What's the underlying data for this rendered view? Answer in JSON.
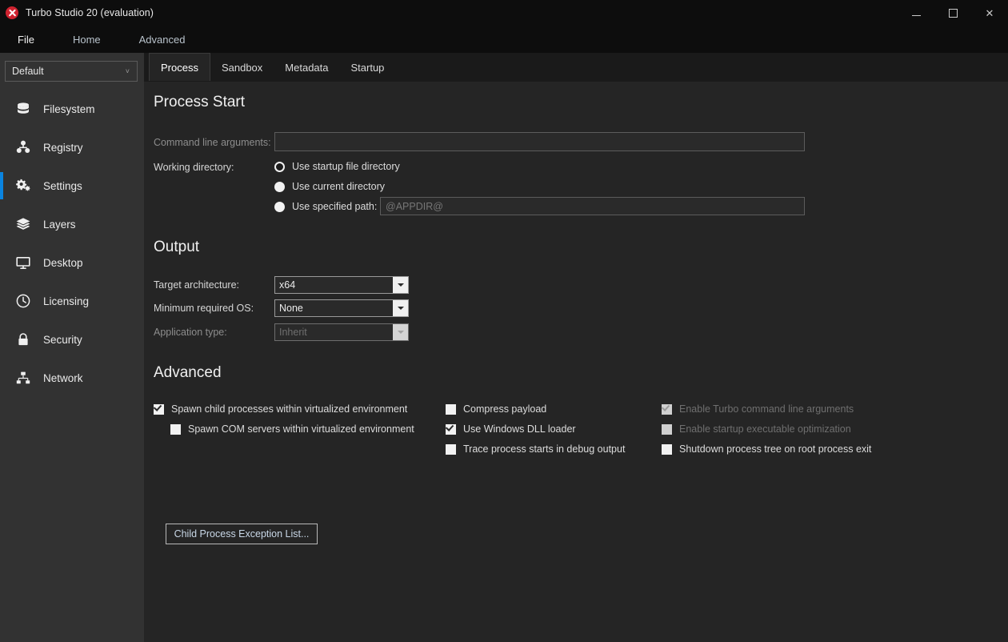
{
  "window": {
    "title": "Turbo Studio 20 (evaluation)",
    "app_icon": "turbo-tools-icon",
    "minimize_label": "Minimize",
    "maximize_label": "Maximize",
    "close_label": "✕",
    "accent_color": "#0a84e0",
    "titlebar_bg": "#0d0d0d",
    "sidebar_bg": "#323232",
    "content_bg": "#252525"
  },
  "menubar": {
    "items": [
      {
        "label": "File",
        "style": "primary"
      },
      {
        "label": "Home",
        "style": "secondary"
      },
      {
        "label": "Advanced",
        "style": "secondary"
      }
    ]
  },
  "sidebar": {
    "profile_combo": {
      "value": "Default",
      "chevron": "˅"
    },
    "items": [
      {
        "label": "Filesystem",
        "icon": "database-icon",
        "active": false
      },
      {
        "label": "Registry",
        "icon": "registry-nodes-icon",
        "active": false
      },
      {
        "label": "Settings",
        "icon": "gears-icon",
        "active": true
      },
      {
        "label": "Layers",
        "icon": "layers-stack-icon",
        "active": false
      },
      {
        "label": "Desktop",
        "icon": "monitor-icon",
        "active": false
      },
      {
        "label": "Licensing",
        "icon": "clock-icon",
        "active": false
      },
      {
        "label": "Security",
        "icon": "lock-icon",
        "active": false
      },
      {
        "label": "Network",
        "icon": "network-icon",
        "active": false
      }
    ]
  },
  "tabs": [
    {
      "label": "Process",
      "active": true
    },
    {
      "label": "Sandbox",
      "active": false
    },
    {
      "label": "Metadata",
      "active": false
    },
    {
      "label": "Startup",
      "active": false
    }
  ],
  "process_start": {
    "heading": "Process Start",
    "command_line": {
      "label": "Command line arguments:",
      "value": "",
      "placeholder": "",
      "disabled": true
    },
    "working_directory": {
      "label": "Working directory:",
      "options": [
        {
          "label": "Use startup file directory",
          "selected": true
        },
        {
          "label": "Use current directory",
          "selected": false
        },
        {
          "label": "Use specified path:",
          "selected": false
        }
      ],
      "path_value": "",
      "path_placeholder": "@APPDIR@"
    }
  },
  "output": {
    "heading": "Output",
    "fields": [
      {
        "label": "Target architecture:",
        "value": "x64",
        "disabled": false
      },
      {
        "label": "Minimum required OS:",
        "value": "None",
        "disabled": false
      },
      {
        "label": "Application type:",
        "value": "Inherit",
        "disabled": true
      }
    ]
  },
  "advanced": {
    "heading": "Advanced",
    "column1": [
      {
        "label": "Spawn child processes within virtualized environment",
        "checked": true,
        "disabled": false,
        "indent": false
      },
      {
        "label": "Spawn COM servers within virtualized environment",
        "checked": false,
        "disabled": false,
        "indent": true
      }
    ],
    "exception_button": "Child Process Exception List...",
    "column2": [
      {
        "label": "Compress payload",
        "checked": false,
        "disabled": false
      },
      {
        "label": "Use Windows DLL loader",
        "checked": true,
        "disabled": false
      },
      {
        "label": "Trace process starts in debug output",
        "checked": false,
        "disabled": false
      }
    ],
    "column3": [
      {
        "label": "Enable Turbo command line arguments",
        "checked": true,
        "disabled": true
      },
      {
        "label": "Enable startup executable optimization",
        "checked": false,
        "disabled": true
      },
      {
        "label": "Shutdown process tree on root process exit",
        "checked": false,
        "disabled": false
      }
    ]
  }
}
